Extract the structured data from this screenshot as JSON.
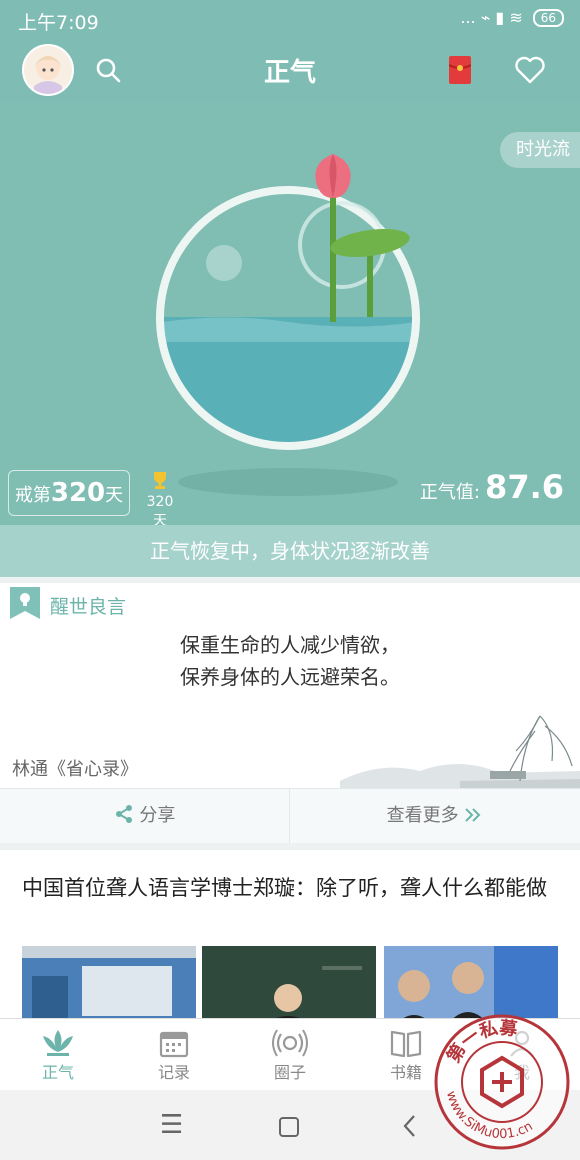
{
  "status_bar": {
    "time": "上午7:09",
    "icons": "... ⌁ ▮ ≋",
    "battery": "66"
  },
  "header": {
    "title": "正气",
    "icons": [
      "search-icon",
      "red-envelope-icon",
      "heart-icon"
    ]
  },
  "hero": {
    "time_flow_button": "时光流",
    "day_prefix": "戒第",
    "day_count": "320",
    "day_suffix": "天",
    "trophy_days": "320天",
    "score_label": "正气值:",
    "score_value": "87.6",
    "status_message": "正气恢复中，身体状况逐渐改善"
  },
  "quote": {
    "section_title": "醒世良言",
    "lines": [
      "保重生命的人减少情欲，",
      "保养身体的人远避荣名。"
    ],
    "author": "林通《省心录》",
    "share_label": "分享",
    "more_label": "查看更多"
  },
  "article": {
    "title": "中国首位聋人语言学博士郑璇：除了听，聋人什么都能做"
  },
  "bottom_nav": {
    "items": [
      {
        "label": "正气",
        "icon": "lotus-icon"
      },
      {
        "label": "记录",
        "icon": "calendar-icon"
      },
      {
        "label": "圈子",
        "icon": "broadcast-icon"
      },
      {
        "label": "书籍",
        "icon": "book-icon"
      },
      {
        "label": "我",
        "icon": "person-icon"
      }
    ]
  },
  "watermark": {
    "text": "第一私募",
    "url": "www.SiMu001.cn"
  },
  "colors": {
    "accent": "#7fbdb4",
    "accent_dark": "#6cb4aa",
    "lotus": "#ec6f80"
  }
}
